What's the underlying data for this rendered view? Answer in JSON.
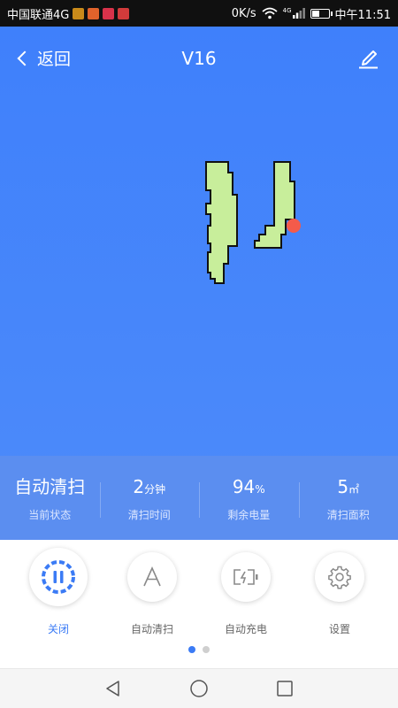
{
  "status_bar": {
    "carrier": "中国联通4G",
    "network_speed": "0K/s",
    "signal_tag": "4G",
    "time": "中午11:51",
    "battery_level": 0.4,
    "badge_colors": [
      "#c98a1a",
      "#e0632b",
      "#d8324a",
      "#d23b3b"
    ]
  },
  "header": {
    "back_label": "返回",
    "title": "V16"
  },
  "stats": [
    {
      "value": "自动清扫",
      "unit": "",
      "label": "当前状态"
    },
    {
      "value": "2",
      "unit": "分钟",
      "label": "清扫时间"
    },
    {
      "value": "94",
      "unit": "%",
      "label": "剩余电量"
    },
    {
      "value": "5",
      "unit": "㎡",
      "label": "清扫面积"
    }
  ],
  "controls": [
    {
      "label": "关闭",
      "icon": "pause-icon",
      "active": true
    },
    {
      "label": "自动清扫",
      "icon": "letter-a-icon",
      "active": false
    },
    {
      "label": "自动充电",
      "icon": "charging-battery-icon",
      "active": false
    },
    {
      "label": "设置",
      "icon": "gear-icon",
      "active": false
    }
  ],
  "pager": {
    "pages": 2,
    "current": 1
  },
  "colors": {
    "accent": "#3b7bf5",
    "map_fill": "#c8ee9b",
    "map_outline": "#111111",
    "robot_marker": "#f45b4a",
    "blue_background": "#4a88fb"
  }
}
